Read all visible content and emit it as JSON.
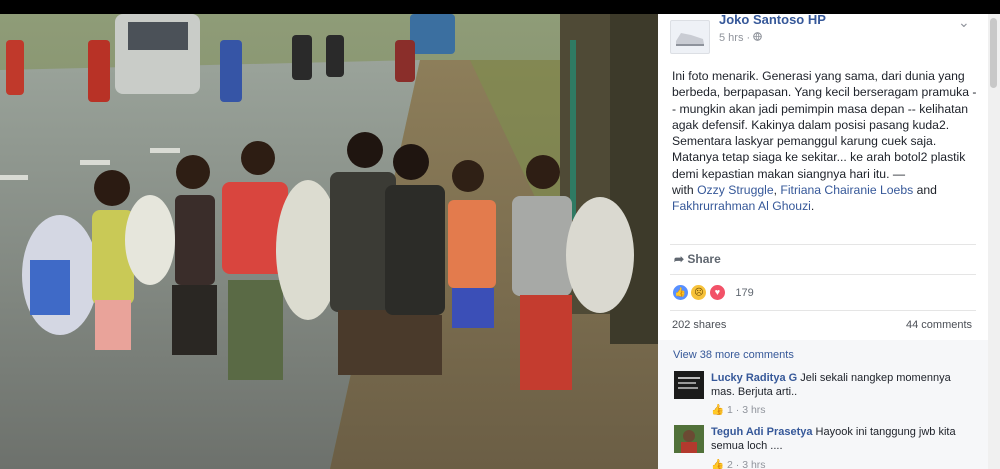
{
  "post": {
    "author": "Joko Santoso HP",
    "time": "5 hrs",
    "privacy_icon": "globe-icon",
    "text": "Ini foto menarik. Generasi yang sama, dari dunia yang berbeda, berpapasan. Yang kecil berseragam pramuka -- mungkin akan jadi pemimpin masa depan -- kelihatan agak defensif. Kakinya dalam posisi pasang kuda2.\nSementara laskyar pemanggul karung cuek saja. Matanya tetap siaga ke sekitar... ke arah botol2 plastik demi kepastian makan siangnya hari itu. —",
    "with_prefix": "with",
    "tags": [
      "Ozzy Struggle",
      "Fitriana Chairanie Loebs",
      "Fakhrurrahman Al Ghouzi"
    ],
    "tag_sep_1": ", ",
    "tag_sep_2": " and",
    "share_label": "Share"
  },
  "stats": {
    "reaction_count": "179",
    "shares": "202 shares",
    "comments": "44 comments"
  },
  "comments_section": {
    "view_more": "View 38 more comments",
    "items": [
      {
        "name": "Lucky Raditya G",
        "text": "Jeli sekali nangkep momennya mas. Berjuta arti..",
        "likes": "1",
        "time": "3 hrs"
      },
      {
        "name": "Teguh Adi Prasetya",
        "text": "Hayook ini tanggung jwb kita semua loch ....",
        "likes": "2",
        "time": "3 hrs"
      }
    ]
  },
  "colors": {
    "link": "#365899",
    "text": "#1d2129",
    "muted": "#90949c"
  }
}
